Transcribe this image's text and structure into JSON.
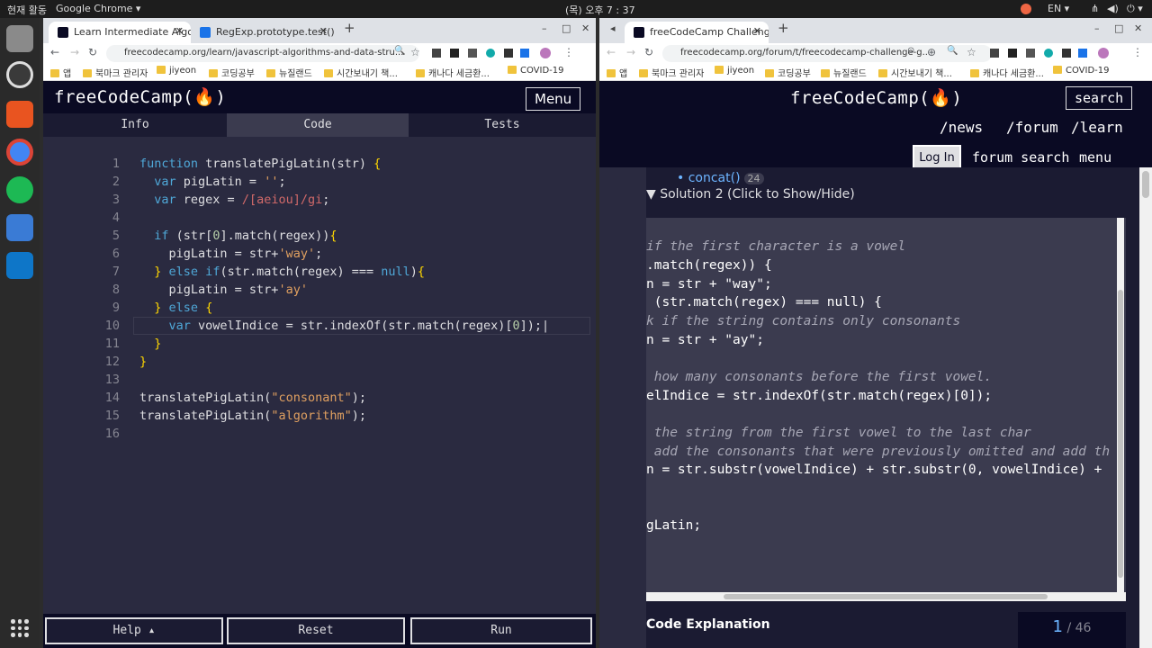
{
  "system": {
    "activities": "현재 활동",
    "app": "Google Chrome ▾",
    "clock": "(목) 오후 7 : 37",
    "lang": "EN ▾"
  },
  "left_window": {
    "tabs": [
      {
        "title": "Learn Intermediate Algo"
      },
      {
        "title": "RegExp.prototype.test()"
      }
    ],
    "url": "freecodecamp.org/learn/javascript-algorithms-and-data-stru...",
    "bookmarks": [
      "앱",
      "북마크 관리자",
      "jiyeon",
      "코딩공부",
      "뉴질랜드",
      "시간보내기 책...",
      "캐나다 세금환...",
      "COVID-19"
    ],
    "logo": "freeCodeCamp(🔥)",
    "menu_label": "Menu",
    "subtabs": [
      "Info",
      "Code",
      "Tests"
    ],
    "code_lines": [
      "function translatePigLatin(str) {",
      "  var pigLatin = '';",
      "  var regex = /[aeiou]/gi;",
      "",
      "  if (str[0].match(regex)){",
      "    pigLatin = str+'way';",
      "  } else if(str.match(regex) === null){",
      "    pigLatin = str+'ay'",
      "  } else {",
      "    var vowelIndice = str.indexOf(str.match(regex)[0]);",
      "  }",
      "}",
      "",
      "translatePigLatin(\"consonant\");",
      "translatePigLatin(\"algorithm\");",
      ""
    ],
    "line_numbers": [
      "1",
      "2",
      "3",
      "4",
      "5",
      "6",
      "7",
      "8",
      "9",
      "10",
      "11",
      "12",
      "13",
      "14",
      "15",
      "16"
    ],
    "buttons": {
      "help": "Help ▴",
      "reset": "Reset",
      "run": "Run"
    }
  },
  "right_window": {
    "tab": {
      "title": "freeCodeCamp Challenge"
    },
    "url": "freecodecamp.org/forum/t/freecodecamp-challenge-g...",
    "bookmarks": [
      "앱",
      "북마크 관리자",
      "jiyeon",
      "코딩공부",
      "뉴질랜드",
      "시간보내기 책...",
      "캐나다 세금환...",
      "COVID-19"
    ],
    "logo": "freeCodeCamp(🔥)",
    "search_label": "search",
    "nav": [
      "/news",
      "/forum",
      "/learn"
    ],
    "login_label": "Log In",
    "forum_search": "forum search",
    "menu_label": "menu",
    "concat_link": "concat()",
    "concat_count": "24",
    "solution_toggle": "▼ Solution 2 (Click to Show/Hide)",
    "solution_lines": [
      "if the first character is a vowel",
      ".match(regex)) {",
      "n = str + \"way\";",
      " (str.match(regex) === null) {",
      "k if the string contains only consonants",
      "n = str + \"ay\";",
      "",
      " how many consonants before the first vowel.",
      "elIndice = str.indexOf(str.match(regex)[0]);",
      "",
      " the string from the first vowel to the last char",
      " add the consonants that were previously omitted and add th",
      "n = str.substr(vowelIndice) + str.substr(0, vowelIndice) +",
      "",
      "",
      "gLatin;"
    ],
    "code_explanation": "Code Explanation",
    "pager_current": "1",
    "pager_total": "46"
  }
}
